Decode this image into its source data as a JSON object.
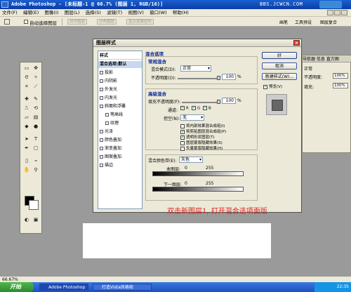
{
  "window": {
    "title": "Adobe Photoshop - [未标题-1 @ 66.7% (图层 1, RGB/16)]",
    "watermark": "BBS.JCWCN.COM"
  },
  "menu": [
    "文件(F)",
    "编辑(E)",
    "图像(I)",
    "图层(L)",
    "选择(S)",
    "滤镜(T)",
    "视图(V)",
    "窗口(W)",
    "帮助(H)"
  ],
  "options_bar": {
    "auto_select_label": "自动选择图层",
    "buttons": [
      "对齐图层",
      "分布图层",
      "显示变换控件"
    ],
    "right_tabs": [
      "画笔",
      "工具预设",
      "图层复合"
    ]
  },
  "right_panel": {
    "tabs": "导航器  信息  直方图",
    "mode": "正常",
    "opacity_label": "不透明度:",
    "fill_label": "填充:",
    "opacity_value": "100%",
    "fill_value": "100%"
  },
  "dialog": {
    "title": "图层样式",
    "close": "×",
    "style_list": [
      {
        "label": "样式",
        "type": "header"
      },
      {
        "label": "混合选项:默认",
        "type": "selected"
      },
      {
        "label": "投影",
        "type": "check"
      },
      {
        "label": "内阴影",
        "type": "check"
      },
      {
        "label": "外发光",
        "type": "check"
      },
      {
        "label": "内发光",
        "type": "check"
      },
      {
        "label": "斜面和浮雕",
        "type": "check"
      },
      {
        "label": "等高线",
        "type": "sub"
      },
      {
        "label": "纹理",
        "type": "sub"
      },
      {
        "label": "光泽",
        "type": "check"
      },
      {
        "label": "颜色叠加",
        "type": "check"
      },
      {
        "label": "渐变叠加",
        "type": "check"
      },
      {
        "label": "图案叠加",
        "type": "check"
      },
      {
        "label": "描边",
        "type": "check"
      }
    ],
    "blend_options_title": "混合选项",
    "general_blending": {
      "title": "常规混合",
      "mode_label": "混合模式(D):",
      "mode_value": "正常",
      "opacity_label": "不透明度(O):",
      "opacity_value": "100",
      "unit": "%"
    },
    "advanced_blending": {
      "title": "高级混合",
      "fill_label": "填充不透明度(F):",
      "fill_value": "100",
      "unit": "%",
      "channels_label": "通道:",
      "channels": [
        "R",
        "G",
        "B"
      ],
      "knockout_label": "挖空(N):",
      "knockout_value": "无",
      "checks": [
        {
          "label": "将内部效果混合成组(I)",
          "checked": false
        },
        {
          "label": "将剪贴图层混合成组(P)",
          "checked": true
        },
        {
          "label": "透明形状图层(T)",
          "checked": true
        },
        {
          "label": "图层蒙版隐藏效果(S)",
          "checked": false
        },
        {
          "label": "矢量蒙版隐藏效果(H)",
          "checked": false
        }
      ]
    },
    "blend_if": {
      "label": "混合颜色带(E):",
      "value": "灰色",
      "this_layer_label": "本图层:",
      "underlying_label": "下一图层:",
      "min": "0",
      "max": "255"
    },
    "buttons": {
      "ok": "好",
      "cancel": "取消",
      "new_style": "新建样式(W)...",
      "preview": "预览(V)"
    }
  },
  "annotation": "双击新图层1, 打开混合选项面版",
  "status": {
    "zoom": "66.67%"
  },
  "taskbar": {
    "start": "开始",
    "tasks": [
      "Adobe Photoshop",
      "打造Vista风格按"
    ],
    "clock": "22:35"
  },
  "colors": {
    "annotation": "#e0201a",
    "section_title": "#0a2a9a",
    "workspace": "#9a9a9a",
    "dialog_bg": "#ece9d8"
  }
}
